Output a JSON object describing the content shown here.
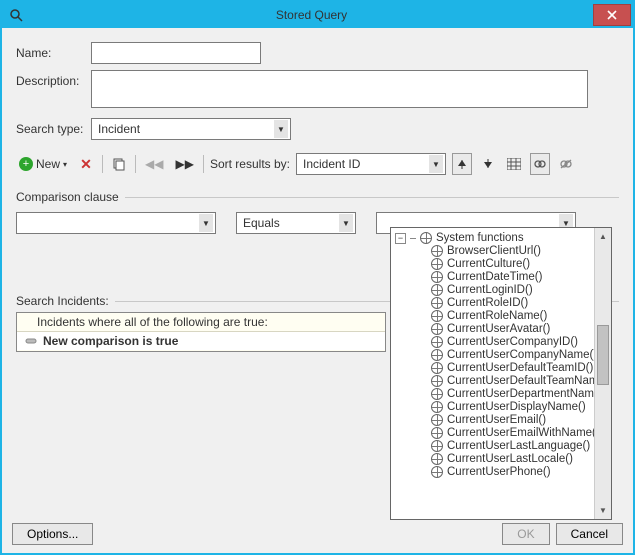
{
  "window": {
    "title": "Stored Query"
  },
  "form": {
    "name_label": "Name:",
    "name_value": "",
    "desc_label": "Description:",
    "desc_value": "",
    "searchtype_label": "Search type:",
    "searchtype_value": "Incident"
  },
  "toolbar": {
    "new_label": "New",
    "sort_label": "Sort results by:",
    "sort_value": "Incident ID"
  },
  "section": {
    "comparison_label": "Comparison clause",
    "search_incidents_label": "Search Incidents:"
  },
  "clause": {
    "field_value": "",
    "op_value": "Equals",
    "val_value": ""
  },
  "searchlist": {
    "header": "Incidents where all of the following are true:",
    "row1": "New comparison is true"
  },
  "dropdown": {
    "root": "System functions",
    "items": [
      "BrowserClientUrl()",
      "CurrentCulture()",
      "CurrentDateTime()",
      "CurrentLoginID()",
      "CurrentRoleID()",
      "CurrentRoleName()",
      "CurrentUserAvatar()",
      "CurrentUserCompanyID()",
      "CurrentUserCompanyName()",
      "CurrentUserDefaultTeamID()",
      "CurrentUserDefaultTeamName()",
      "CurrentUserDepartmentName()",
      "CurrentUserDisplayName()",
      "CurrentUserEmail()",
      "CurrentUserEmailWithName()",
      "CurrentUserLastLanguage()",
      "CurrentUserLastLocale()",
      "CurrentUserPhone()"
    ]
  },
  "footer": {
    "options": "Options...",
    "ok": "OK",
    "cancel": "Cancel"
  }
}
